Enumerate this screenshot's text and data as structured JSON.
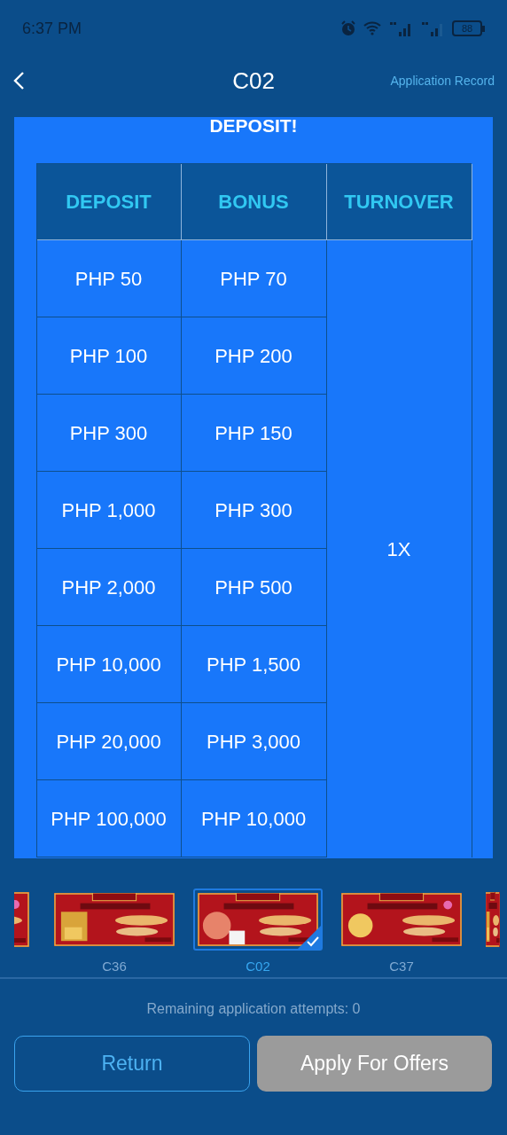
{
  "status_bar": {
    "time": "6:37 PM",
    "battery": "88"
  },
  "header": {
    "title": "C02",
    "link": "Application Record"
  },
  "promo": {
    "heading": "DEPOSIT!",
    "table": {
      "columns": [
        "DEPOSIT",
        "BONUS",
        "TURNOVER"
      ],
      "rows": [
        [
          "PHP 50",
          "PHP 70"
        ],
        [
          "PHP 100",
          "PHP 200"
        ],
        [
          "PHP 300",
          "PHP 150"
        ],
        [
          "PHP 1,000",
          "PHP 300"
        ],
        [
          "PHP 2,000",
          "PHP 500"
        ],
        [
          "PHP 10,000",
          "PHP 1,500"
        ],
        [
          "PHP 20,000",
          "PHP 3,000"
        ],
        [
          "PHP 100,000",
          "PHP 10,000"
        ]
      ],
      "turnover": "1X"
    }
  },
  "offers": [
    {
      "label": "C36",
      "selected": false
    },
    {
      "label": "C02",
      "selected": true
    },
    {
      "label": "C37",
      "selected": false
    }
  ],
  "remaining": "Remaining application attempts: 0",
  "buttons": {
    "return": "Return",
    "apply": "Apply For Offers",
    "apply_disabled": true
  }
}
